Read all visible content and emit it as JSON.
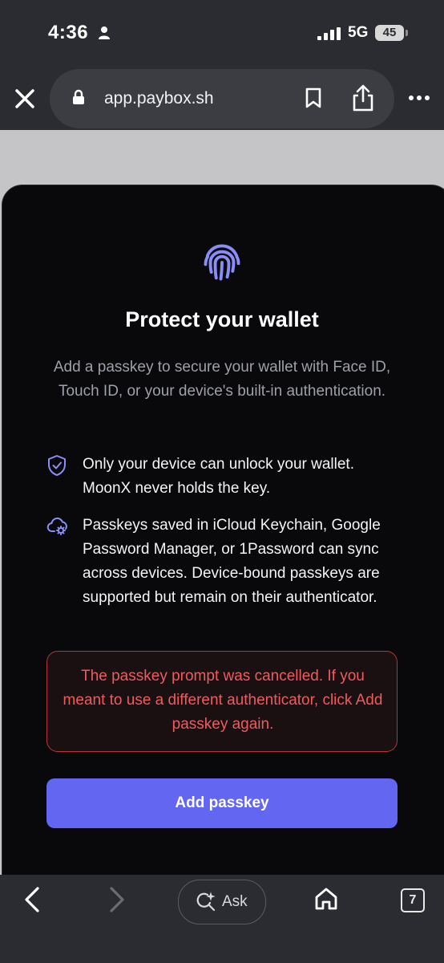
{
  "status_bar": {
    "time": "4:36",
    "network": "5G",
    "battery": "45"
  },
  "browser": {
    "url": "app.paybox.sh"
  },
  "card": {
    "title": "Protect your wallet",
    "subtitle": "Add a passkey to secure your wallet with Face ID, Touch ID, or your device's built-in authentication.",
    "features": [
      {
        "icon": "shield-check-icon",
        "text": "Only your device can unlock your wallet. MoonX never holds the key."
      },
      {
        "icon": "cloud-sync-icon",
        "text": "Passkeys saved in iCloud Keychain, Google Password Manager, or 1Password can sync across devices. Device-bound passkeys are supported but remain on their authenticator."
      }
    ],
    "alert": "The passkey prompt was cancelled. If you meant to use a different authenticator, click Add passkey again.",
    "button": "Add passkey"
  },
  "toolbar": {
    "ask_label": "Ask",
    "tab_count": "7"
  },
  "colors": {
    "accent": "#6366f1",
    "error": "#ee5b5f",
    "icon": "#8b8cf8"
  }
}
